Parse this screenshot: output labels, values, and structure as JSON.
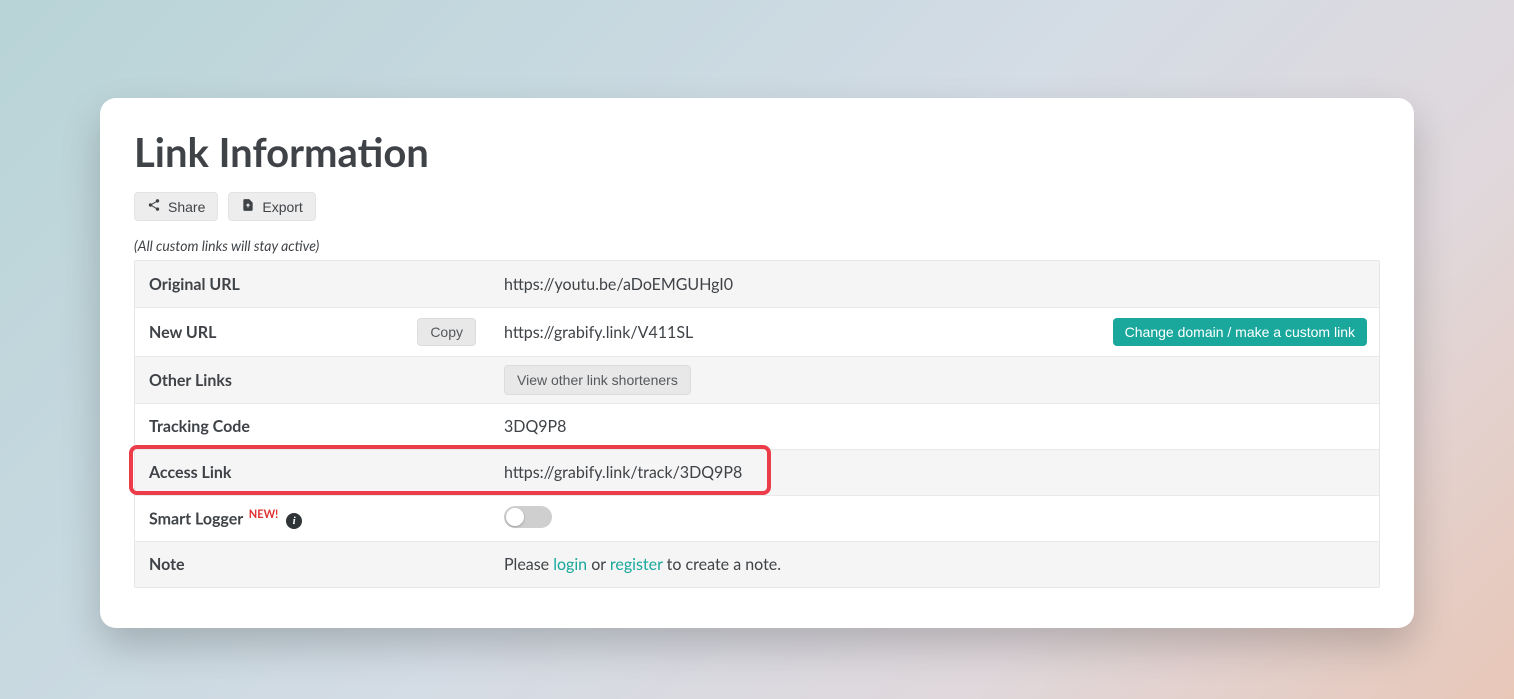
{
  "header": {
    "title": "Link Information",
    "share_label": "Share",
    "export_label": "Export",
    "subnote": "(All custom links will stay active)"
  },
  "rows": {
    "original_url": {
      "label": "Original URL",
      "value": "https://youtu.be/aDoEMGUHgI0"
    },
    "new_url": {
      "label": "New URL",
      "copy_label": "Copy",
      "value": "https://grabify.link/V411SL",
      "change_domain_label": "Change domain / make a custom link"
    },
    "other_links": {
      "label": "Other Links",
      "view_label": "View other link shorteners"
    },
    "tracking_code": {
      "label": "Tracking Code",
      "value": "3DQ9P8"
    },
    "access_link": {
      "label": "Access Link",
      "value": "https://grabify.link/track/3DQ9P8"
    },
    "smart_logger": {
      "label": "Smart Logger",
      "badge": "NEW!",
      "info_glyph": "i",
      "toggle_on": false
    },
    "note": {
      "label": "Note",
      "prefix": "Please ",
      "login": "login",
      "mid": " or ",
      "register": "register",
      "suffix": " to create a note."
    }
  }
}
